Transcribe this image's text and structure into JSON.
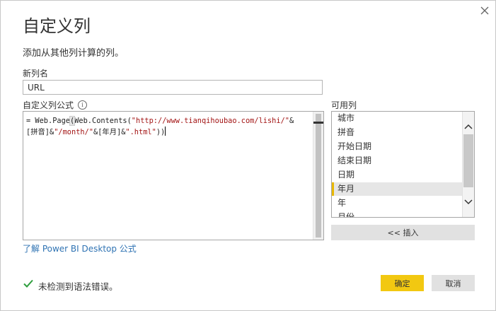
{
  "dialog": {
    "title": "自定义列",
    "subtitle": "添加从其他列计算的列。",
    "close_icon": "close-icon"
  },
  "new_column": {
    "label": "新列名",
    "value": "URL"
  },
  "formula": {
    "label": "自定义列公式",
    "info_icon": "info-icon",
    "line1_prefix": "= Web.Page",
    "line1_paren": "(",
    "line1_mid": "Web.Contents(",
    "line1_str": "\"http://www.tianqihoubao.com/lishi/\"",
    "line1_end": "&",
    "line2_a": "[拼音]&",
    "line2_str1": "\"/month/\"",
    "line2_b": "&[年月]&",
    "line2_str2": "\".html\"",
    "line2_c": "))",
    "learn_link": "了解 Power BI Desktop 公式"
  },
  "available_columns": {
    "label": "可用列",
    "items": [
      "城市",
      "拼音",
      "开始日期",
      "结束日期",
      "日期",
      "年月",
      "年",
      "月份"
    ],
    "selected": "年月",
    "scroll_up_icon": "chevron-up-icon",
    "scroll_down_icon": "chevron-down-icon",
    "insert_label": "<< 插入"
  },
  "status": {
    "icon": "check-icon",
    "text": "未检测到语法错误。",
    "color": "#2e9e3e"
  },
  "buttons": {
    "ok_label": "确定",
    "cancel_label": "取消",
    "ok_color": "#f2c811"
  }
}
